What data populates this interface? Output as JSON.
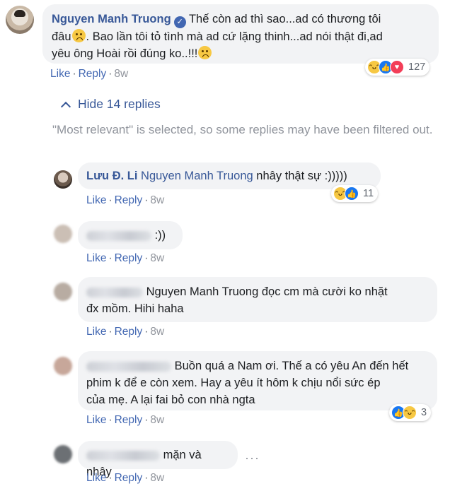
{
  "main_comment": {
    "author": "Nguyen Manh Truong",
    "text_line1_a": "Thế còn ad thì sao...ad có thương tôi",
    "text_line2_a": "đâu",
    "text_line2_b": ". Bao lần tôi tỏ tình mà ad cứ lặng thinh...ad nói thật đi,ad",
    "text_line3_a": "yêu ông Hoài rồi đúng ko..!!!",
    "like": "Like",
    "reply": "Reply",
    "time": "8w",
    "reactions_count": "127"
  },
  "hide_replies_label": "Hide 14 replies",
  "filter_notice": "\"Most relevant\" is selected, so some replies may have been filtered out.",
  "replies": [
    {
      "author": "Lưu Đ. Li",
      "tag": "Nguyen Manh Truong",
      "text": " nhây thật sự :)))))",
      "like": "Like",
      "reply": "Reply",
      "time": "8w",
      "reactions_count": "11"
    },
    {
      "text": ":))",
      "like": "Like",
      "reply": "Reply",
      "time": "8w"
    },
    {
      "tag": "Nguyen Manh Truong",
      "text_a": " đọc cm mà cười ko nhặt",
      "text_b": "đx mồm. Hihi haha",
      "like": "Like",
      "reply": "Reply",
      "time": "8w"
    },
    {
      "text_a": "Buồn quá a Nam ơi. Thế a có yêu An đến hết",
      "text_b": "phim k để e còn xem. Hay a yêu ít hôm k chịu nổi sức ép",
      "text_c": "của mẹ. A lại fai bỏ con nhà ngta",
      "like": "Like",
      "reply": "Reply",
      "time": "8w",
      "reactions_count": "3"
    },
    {
      "text": "mặn và nhây",
      "like": "Like",
      "reply": "Reply",
      "time": "8w"
    }
  ]
}
